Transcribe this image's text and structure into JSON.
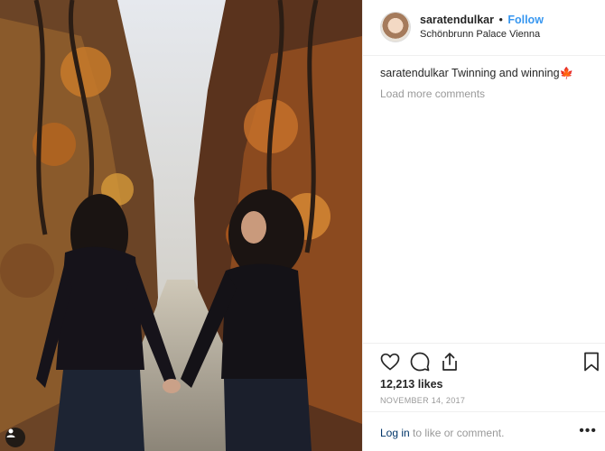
{
  "post": {
    "username": "saratendulkar",
    "separator": "•",
    "follow_label": "Follow",
    "location": "Schönbrunn Palace Vienna",
    "caption_user": "saratendulkar",
    "caption_text": "Twinning and winning🍁",
    "load_more": "Load more comments",
    "likes": "12,213 likes",
    "date": "NOVEMBER 14, 2017",
    "login_link": "Log in",
    "login_rest": "to like or comment.",
    "more_menu": "•••"
  },
  "icons": {
    "like": "heart-icon",
    "comment": "comment-icon",
    "share": "share-icon",
    "save": "bookmark-icon",
    "tag": "user-tag-icon"
  },
  "colors": {
    "follow": "#3897f0",
    "link": "#003569",
    "muted": "#999999",
    "border": "#efefef"
  }
}
